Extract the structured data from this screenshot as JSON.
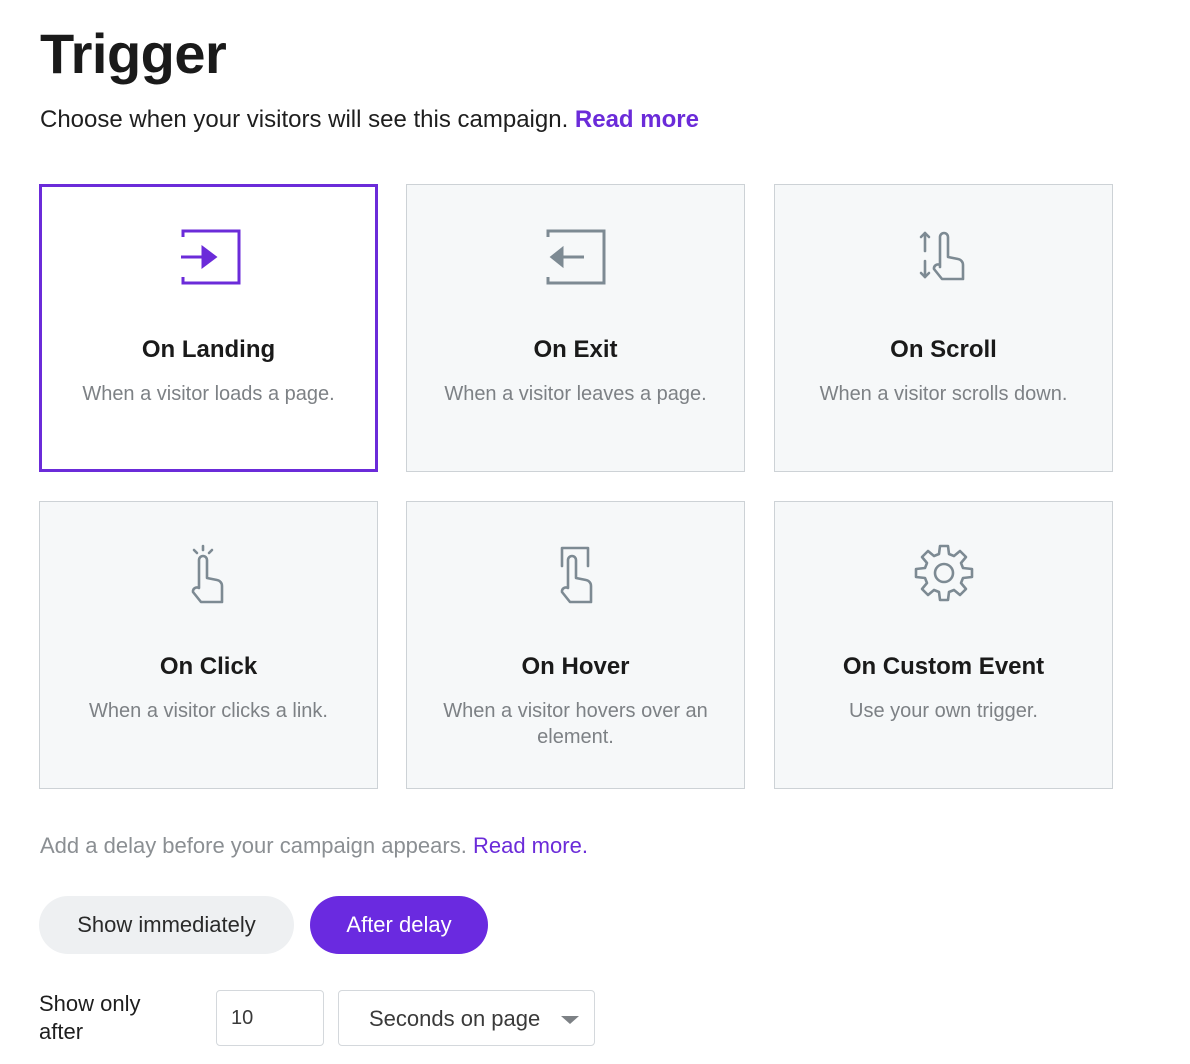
{
  "page": {
    "title": "Trigger",
    "subtitle": "Choose when your visitors will see this campaign.",
    "subtitle_link": "Read more"
  },
  "colors": {
    "accent": "#6b2bd9",
    "card_bg": "#f6f8f9",
    "card_border": "#cdd2d6",
    "icon_gray": "#7d8a93"
  },
  "triggers": [
    {
      "title": "On Landing",
      "description": "When a visitor loads a page.",
      "icon": "enter-icon",
      "selected": true
    },
    {
      "title": "On Exit",
      "description": "When a visitor leaves a page.",
      "icon": "exit-icon",
      "selected": false
    },
    {
      "title": "On Scroll",
      "description": "When a visitor scrolls down.",
      "icon": "scroll-hand-icon",
      "selected": false
    },
    {
      "title": "On Click",
      "description": "When a visitor clicks a link.",
      "icon": "click-hand-icon",
      "selected": false
    },
    {
      "title": "On Hover",
      "description": "When a visitor hovers over an element.",
      "icon": "hover-hand-icon",
      "selected": false
    },
    {
      "title": "On Custom Event",
      "description": "Use your own trigger.",
      "icon": "gear-icon",
      "selected": false
    }
  ],
  "delay": {
    "text": "Add a delay before your campaign appears.",
    "link": "Read more",
    "link_suffix": ".",
    "show_immediately_label": "Show immediately",
    "after_delay_label": "After delay",
    "selected": "After delay",
    "show_only_after_label": "Show only after",
    "value": "10",
    "unit": "Seconds on page"
  }
}
